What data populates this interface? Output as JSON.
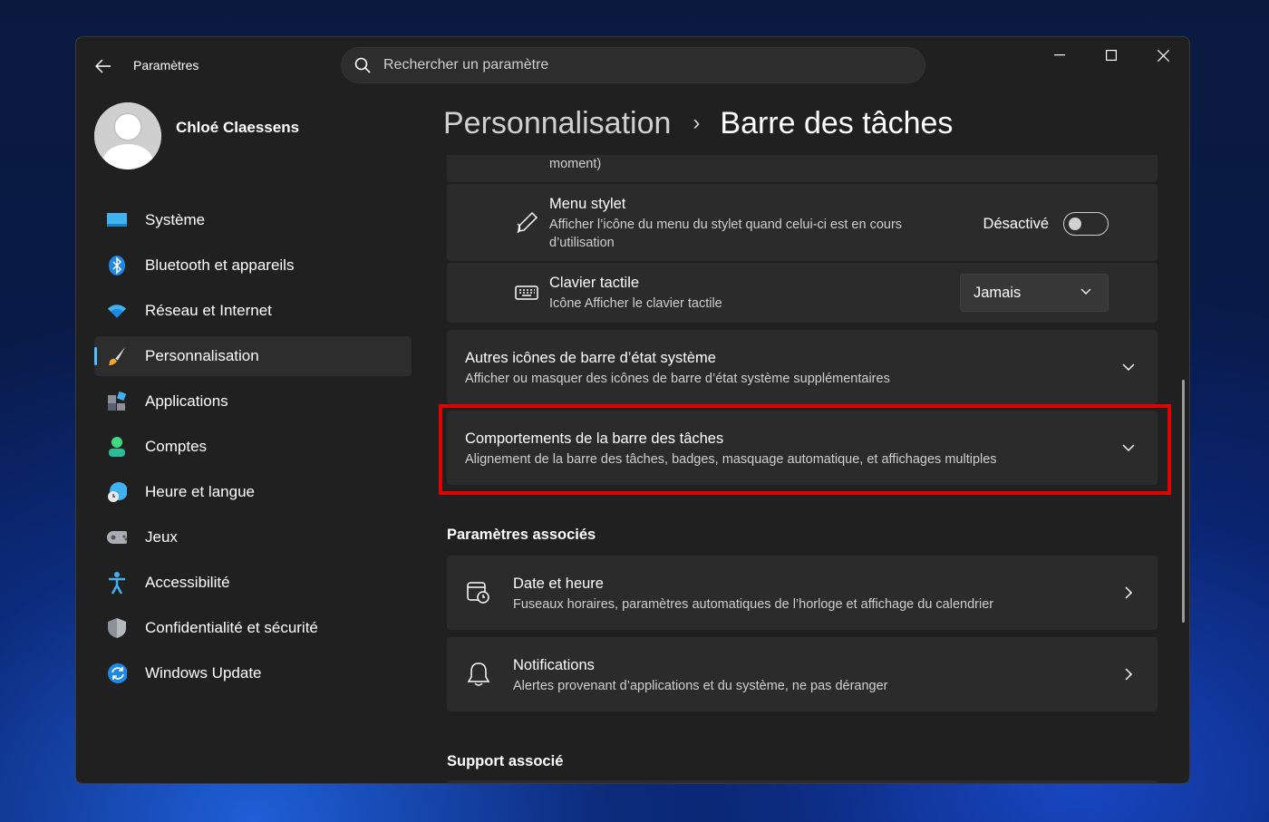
{
  "window": {
    "app_title": "Paramètres",
    "search_placeholder": "Rechercher un paramètre"
  },
  "user": {
    "name": "Chloé Claessens"
  },
  "sidebar": {
    "items": [
      {
        "label": "Système",
        "icon": "system-monitor-icon"
      },
      {
        "label": "Bluetooth et appareils",
        "icon": "bluetooth-icon"
      },
      {
        "label": "Réseau et Internet",
        "icon": "wifi-icon"
      },
      {
        "label": "Personnalisation",
        "icon": "brush-icon",
        "active": true
      },
      {
        "label": "Applications",
        "icon": "apps-icon"
      },
      {
        "label": "Comptes",
        "icon": "account-icon"
      },
      {
        "label": "Heure et langue",
        "icon": "globe-clock-icon"
      },
      {
        "label": "Jeux",
        "icon": "gamepad-icon"
      },
      {
        "label": "Accessibilité",
        "icon": "accessibility-icon"
      },
      {
        "label": "Confidentialité et sécurité",
        "icon": "shield-icon"
      },
      {
        "label": "Windows Update",
        "icon": "update-icon"
      }
    ]
  },
  "breadcrumb": {
    "parent": "Personnalisation",
    "separator": "›",
    "current": "Barre des tâches"
  },
  "content": {
    "partial_top_text": "moment)",
    "pen_menu": {
      "title": "Menu stylet",
      "desc": "Afficher l’icône du menu du stylet quand celui-ci est en cours d’utilisation",
      "toggle_label": "Désactivé",
      "toggle_on": false
    },
    "touch_keyboard": {
      "title": "Clavier tactile",
      "desc": "Icône Afficher le clavier tactile",
      "dropdown_value": "Jamais"
    },
    "system_tray": {
      "title": "Autres icônes de barre d’état système",
      "desc": "Afficher ou masquer des icônes de barre d’état système supplémentaires"
    },
    "taskbar_behaviors": {
      "title": "Comportements de la barre des tâches",
      "desc": "Alignement de la barre des tâches, badges, masquage automatique, et affichages multiples"
    },
    "related_settings_title": "Paramètres associés",
    "date_time": {
      "title": "Date et heure",
      "desc": "Fuseaux horaires, paramètres automatiques de l’horloge et affichage du calendrier"
    },
    "notifications": {
      "title": "Notifications",
      "desc": "Alertes provenant d’applications et du système, ne pas déranger"
    },
    "related_support_title": "Support associé"
  },
  "colors": {
    "accent": "#4cc2ff",
    "highlight": "#e00000",
    "card": "#2b2b2b",
    "window": "#202020"
  }
}
